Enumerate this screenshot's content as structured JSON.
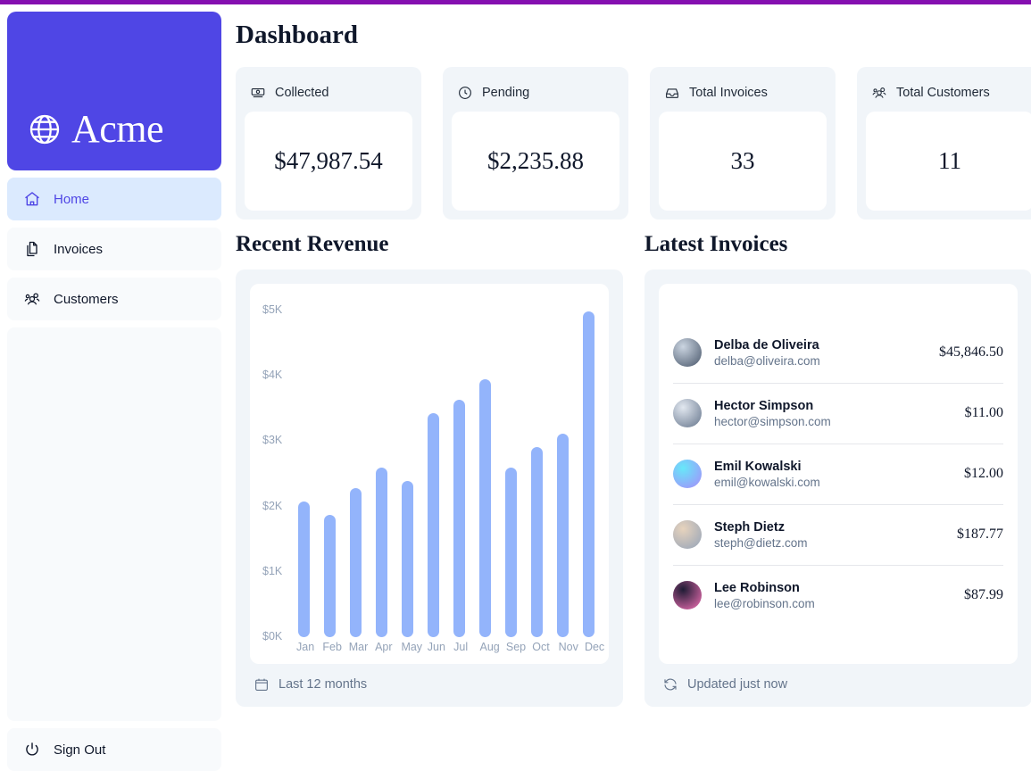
{
  "brand": {
    "name": "Acme",
    "logo_icon": "globe-icon",
    "bg_color": "#4f46e5"
  },
  "top_progress": {
    "color": "#8510b0"
  },
  "sidebar": {
    "items": [
      {
        "label": "Home",
        "icon": "home-icon",
        "active": true
      },
      {
        "label": "Invoices",
        "icon": "document-duplicate-icon",
        "active": false
      },
      {
        "label": "Customers",
        "icon": "user-group-icon",
        "active": false
      }
    ],
    "signout": {
      "label": "Sign Out",
      "icon": "power-icon"
    }
  },
  "header": {
    "title": "Dashboard"
  },
  "cards": [
    {
      "label": "Collected",
      "value": "$47,987.54",
      "icon": "banknotes-icon"
    },
    {
      "label": "Pending",
      "value": "$2,235.88",
      "icon": "clock-icon"
    },
    {
      "label": "Total Invoices",
      "value": "33",
      "icon": "inbox-icon"
    },
    {
      "label": "Total Customers",
      "value": "11",
      "icon": "user-group-icon"
    }
  ],
  "revenue": {
    "title": "Recent Revenue",
    "footer": {
      "label": "Last 12 months",
      "icon": "calendar-icon"
    }
  },
  "invoices": {
    "title": "Latest Invoices",
    "footer": {
      "label": "Updated just now",
      "icon": "refresh-icon"
    },
    "rows": [
      {
        "name": "Delba de Oliveira",
        "email": "delba@oliveira.com",
        "amount": "$45,846.50",
        "avatar_colors": [
          "#cbd5e1",
          "#475569"
        ]
      },
      {
        "name": "Hector Simpson",
        "email": "hector@simpson.com",
        "amount": "$11.00",
        "avatar_colors": [
          "#e2e8f0",
          "#64748b"
        ]
      },
      {
        "name": "Emil Kowalski",
        "email": "emil@kowalski.com",
        "amount": "$12.00",
        "avatar_colors": [
          "#67e8f9",
          "#a78bfa"
        ]
      },
      {
        "name": "Steph Dietz",
        "email": "steph@dietz.com",
        "amount": "$187.77",
        "avatar_colors": [
          "#e7d3bd",
          "#94a3b8"
        ]
      },
      {
        "name": "Lee Robinson",
        "email": "lee@robinson.com",
        "amount": "$87.99",
        "avatar_colors": [
          "#1e1b34",
          "#f472b6"
        ]
      }
    ]
  },
  "chart_data": {
    "type": "bar",
    "title": "Recent Revenue",
    "xlabel": "",
    "ylabel": "",
    "categories": [
      "Jan",
      "Feb",
      "Mar",
      "Apr",
      "May",
      "Jun",
      "Jul",
      "Aug",
      "Sep",
      "Oct",
      "Nov",
      "Dec"
    ],
    "values": [
      2000,
      1800,
      2200,
      2500,
      2300,
      3300,
      3500,
      3800,
      2500,
      2800,
      3000,
      4800
    ],
    "y_ticks": [
      "$5K",
      "$4K",
      "$3K",
      "$2K",
      "$1K",
      "$0K"
    ],
    "ylim": [
      0,
      5000
    ],
    "grid": false,
    "legend": false,
    "bar_color": "#93b4fb"
  }
}
